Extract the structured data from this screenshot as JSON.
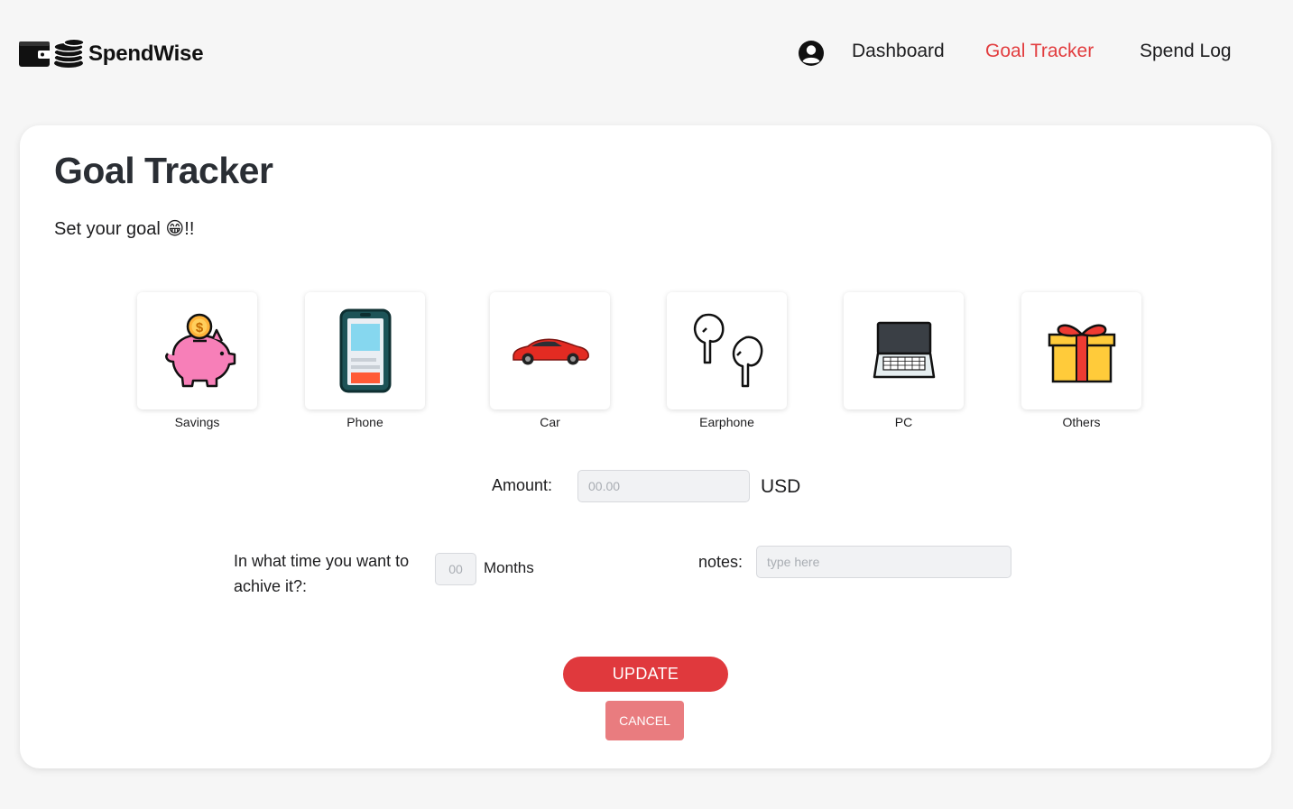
{
  "brand": {
    "name": "SpendWise",
    "accent": "#e23d3f"
  },
  "nav": {
    "user_icon": "user-circle-icon",
    "items": [
      {
        "label": "Dashboard",
        "active": false
      },
      {
        "label": "Goal Tracker",
        "active": true
      },
      {
        "label": "Spend Log",
        "active": false
      }
    ]
  },
  "page": {
    "title": "Goal Tracker",
    "subtitle": "Set your goal 😁!!"
  },
  "categories": [
    {
      "label": "Savings",
      "icon": "piggy-bank-icon"
    },
    {
      "label": "Phone",
      "icon": "phone-icon"
    },
    {
      "label": "Car",
      "icon": "car-icon"
    },
    {
      "label": "Earphone",
      "icon": "earphone-icon"
    },
    {
      "label": "PC",
      "icon": "laptop-icon"
    },
    {
      "label": "Others",
      "icon": "gift-icon"
    }
  ],
  "form": {
    "amount_label": "Amount:",
    "amount_placeholder": "00.00",
    "amount_value": "",
    "currency": "USD",
    "time_label_line1": "In what time you want to",
    "time_label_line2": "achive it?:",
    "months_placeholder": "00",
    "months_value": "",
    "months_unit": "Months",
    "notes_label": "notes:",
    "notes_placeholder": "type here",
    "notes_value": ""
  },
  "buttons": {
    "update": "UPDATE",
    "cancel": "CANCEL"
  },
  "colors": {
    "update_bg": "#e0393d",
    "cancel_bg": "#e97c7f",
    "page_bg": "#f6f6f6",
    "card_bg": "#ffffff"
  }
}
